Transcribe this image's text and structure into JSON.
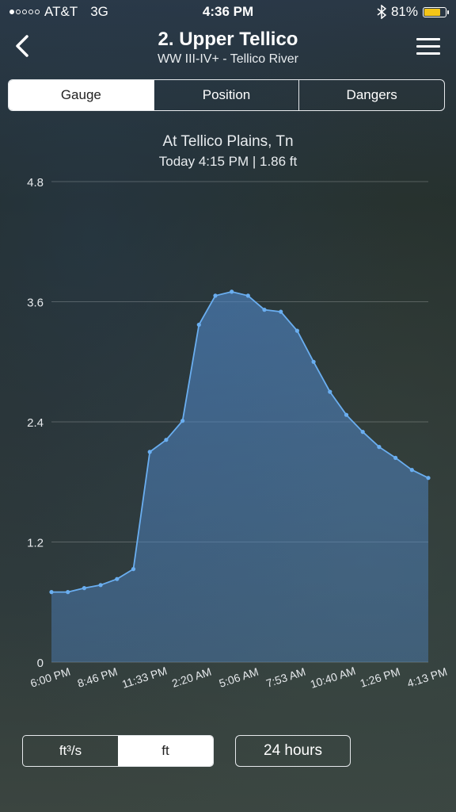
{
  "status": {
    "carrier": "AT&T",
    "network": "3G",
    "time": "4:36 PM",
    "battery": "81%",
    "battery_level": 0.81,
    "signal_bars": 1,
    "icons": [
      "signal-dots-icon",
      "bluetooth-icon",
      "battery-icon"
    ]
  },
  "nav": {
    "title": "2. Upper Tellico",
    "subtitle": "WW III-IV+ - Tellico River",
    "icons": [
      "back-chevron-icon",
      "hamburger-menu-icon"
    ]
  },
  "tabs": [
    {
      "label": "Gauge",
      "active": true
    },
    {
      "label": "Position",
      "active": false
    },
    {
      "label": "Dangers",
      "active": false
    }
  ],
  "gauge": {
    "location": "At Tellico Plains, Tn",
    "reading": "Today 4:15 PM | 1.86 ft"
  },
  "chart_data": {
    "type": "area",
    "title": "",
    "xlabel": "",
    "ylabel": "",
    "ylim": [
      0,
      4.8
    ],
    "y_ticks": [
      "4.8",
      "3.6",
      "2.4",
      "1.2",
      "0"
    ],
    "x_ticks": [
      "6:00 PM",
      "8:46 PM",
      "11:33 PM",
      "2:20 AM",
      "5:06 AM",
      "7:53 AM",
      "10:40 AM",
      "1:26 PM",
      "4:13 PM"
    ],
    "grid": true,
    "fill_color": "#4f86c6",
    "line_color": "#6aaef0",
    "series": [
      {
        "values": [
          0.7,
          0.7,
          0.74,
          0.77,
          0.83,
          0.93,
          2.1,
          2.22,
          2.41,
          3.37,
          3.66,
          3.7,
          3.66,
          3.52,
          3.5,
          3.31,
          3.0,
          2.7,
          2.47,
          2.3,
          2.15,
          2.04,
          1.92,
          1.84
        ]
      }
    ]
  },
  "controls": {
    "unit_options": [
      {
        "label": "ft³/s",
        "active": false
      },
      {
        "label": "ft",
        "active": true
      }
    ],
    "range": "24 hours"
  }
}
